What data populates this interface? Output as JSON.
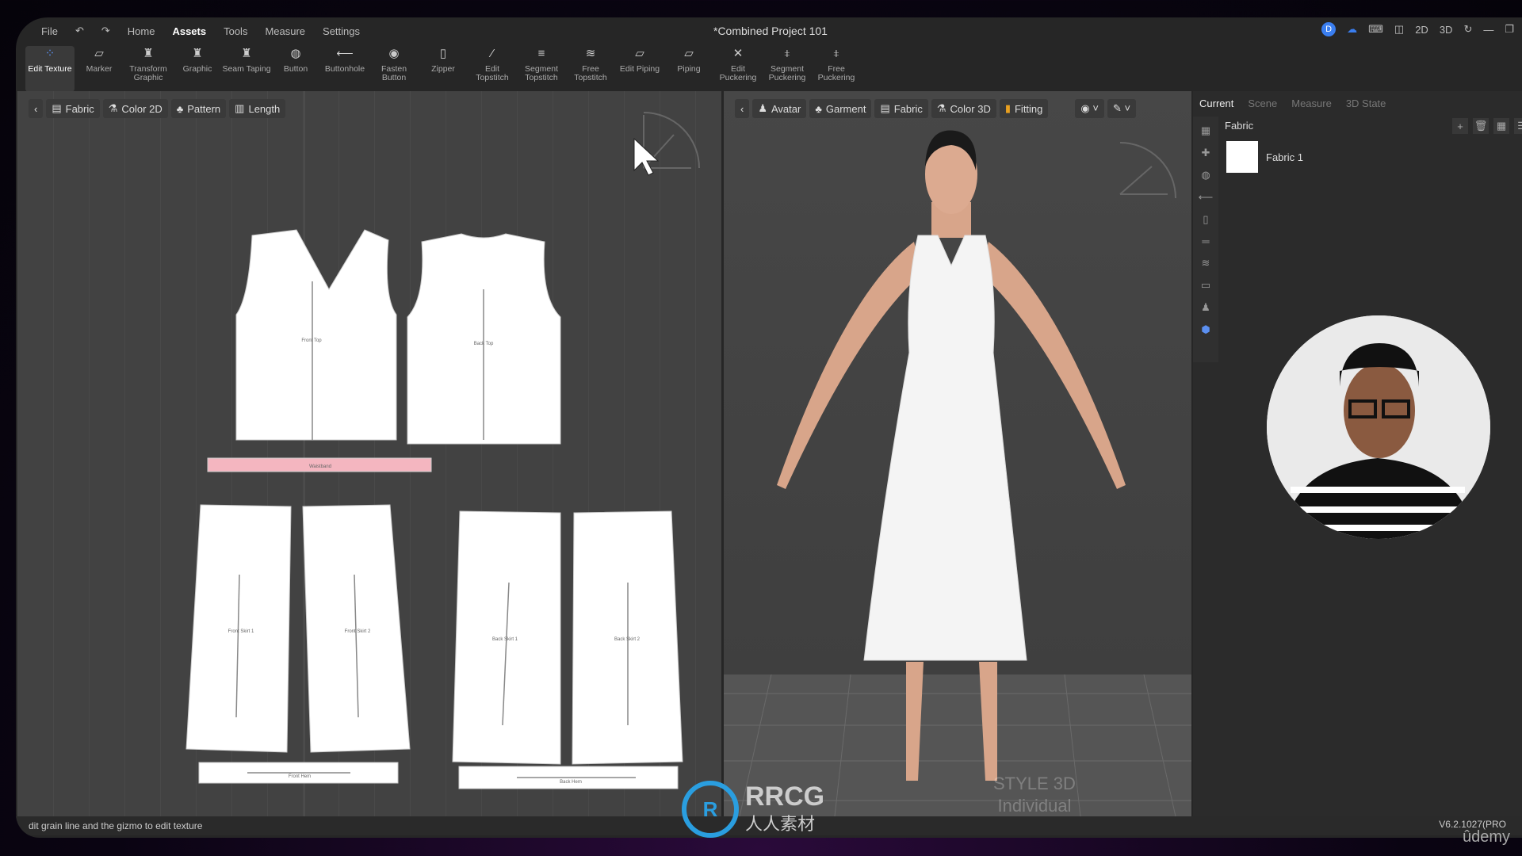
{
  "app": {
    "title": "*Combined Project 101",
    "user_initial": "D"
  },
  "menu": [
    "File",
    "Home",
    "Assets",
    "Tools",
    "Measure",
    "Settings"
  ],
  "menu_active": "Assets",
  "view_buttons": [
    "2D",
    "3D"
  ],
  "toolbar": [
    {
      "label": "Edit Texture",
      "icon": "edit-texture-icon",
      "active": true
    },
    {
      "label": "Marker",
      "icon": "marker-icon"
    },
    {
      "label": "Transform Graphic",
      "icon": "transform-graphic-icon"
    },
    {
      "label": "Graphic",
      "icon": "graphic-icon"
    },
    {
      "label": "Seam Taping",
      "icon": "seam-taping-icon"
    },
    {
      "label": "Button",
      "icon": "button-icon"
    },
    {
      "label": "Buttonhole",
      "icon": "buttonhole-icon"
    },
    {
      "label": "Fasten Button",
      "icon": "fasten-button-icon"
    },
    {
      "label": "Zipper",
      "icon": "zipper-icon"
    },
    {
      "label": "Edit Topstitch",
      "icon": "edit-topstitch-icon"
    },
    {
      "label": "Segment Topstitch",
      "icon": "segment-topstitch-icon"
    },
    {
      "label": "Free Topstitch",
      "icon": "free-topstitch-icon"
    },
    {
      "label": "Edit Piping",
      "icon": "edit-piping-icon"
    },
    {
      "label": "Piping",
      "icon": "piping-icon"
    },
    {
      "label": "Edit Puckering",
      "icon": "edit-puckering-icon"
    },
    {
      "label": "Segment Puckering",
      "icon": "segment-puckering-icon"
    },
    {
      "label": "Free Puckering",
      "icon": "free-puckering-icon"
    }
  ],
  "panel2d": {
    "chips": [
      "Fabric",
      "Color 2D",
      "Pattern",
      "Length"
    ],
    "pieces": [
      "Front Top",
      "Back Top",
      "Waistband",
      "Front Skirt 1",
      "Front Skirt 2",
      "Back Skirt 1",
      "Back Skirt 2",
      "Front Hem",
      "Back Hem"
    ]
  },
  "panel3d": {
    "chips": [
      "Avatar",
      "Garment",
      "Fabric",
      "Color 3D",
      "Fitting"
    ],
    "brand": "STYLE 3D",
    "edition": "Individual"
  },
  "right": {
    "tabs": [
      "Current",
      "Scene",
      "Measure",
      "3D State"
    ],
    "active_tab": "Current",
    "section": "Fabric",
    "fabrics": [
      {
        "name": "Fabric 1",
        "color": "#ffffff"
      }
    ]
  },
  "status": {
    "hint": "dit grain line and the gizmo to edit texture",
    "version": "V6.2.1027(PRO"
  },
  "watermark": {
    "logo": "RRCG",
    "sub": "人人素材"
  },
  "udemy": "ûdemy",
  "colors": {
    "accent": "#3a7ef0",
    "waistband": "#f4b6c0"
  }
}
